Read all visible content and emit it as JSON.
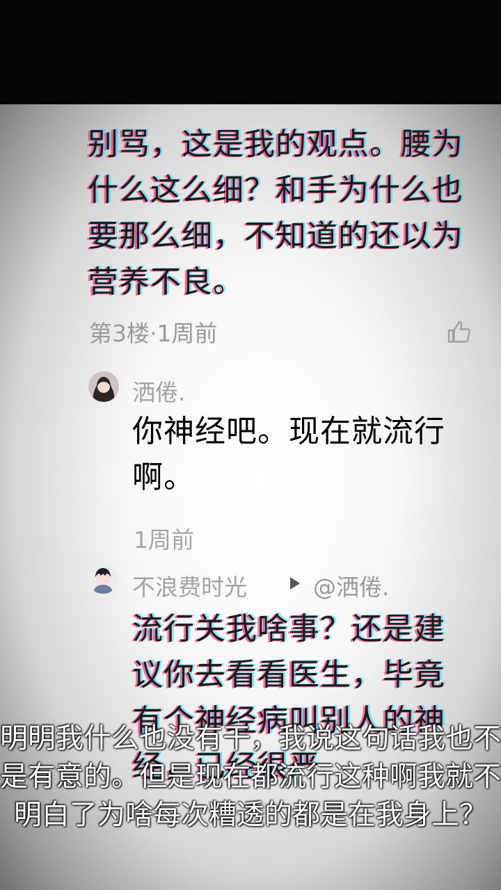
{
  "comment": {
    "text": "别骂，这是我的观点。腰为什么这么细？和手为什么也要那么细，不知道的还以为营养不良。",
    "floor_meta": "第3楼·1周前",
    "like_icon": "thumbs-up-icon"
  },
  "replies": [
    {
      "username": "洒倦.",
      "text": "你神经吧。现在就流行啊。",
      "time": "1周前"
    },
    {
      "username": "不浪费时光",
      "mention": "@洒倦.",
      "text": "流行关我啥事？还是建议你去看看医生，毕竟有个神经病叫别人的神经，已经很严"
    }
  ],
  "caption": "明明我什么也没有干，我说这句话我也不是有意的。但是现在都流行这种啊我就不明白了为啥每次糟透的都是在我身上？",
  "colors": {
    "glitch_red": "#ff005a",
    "glitch_cyan": "#00d2ff",
    "caption_text": "#ffffff"
  }
}
